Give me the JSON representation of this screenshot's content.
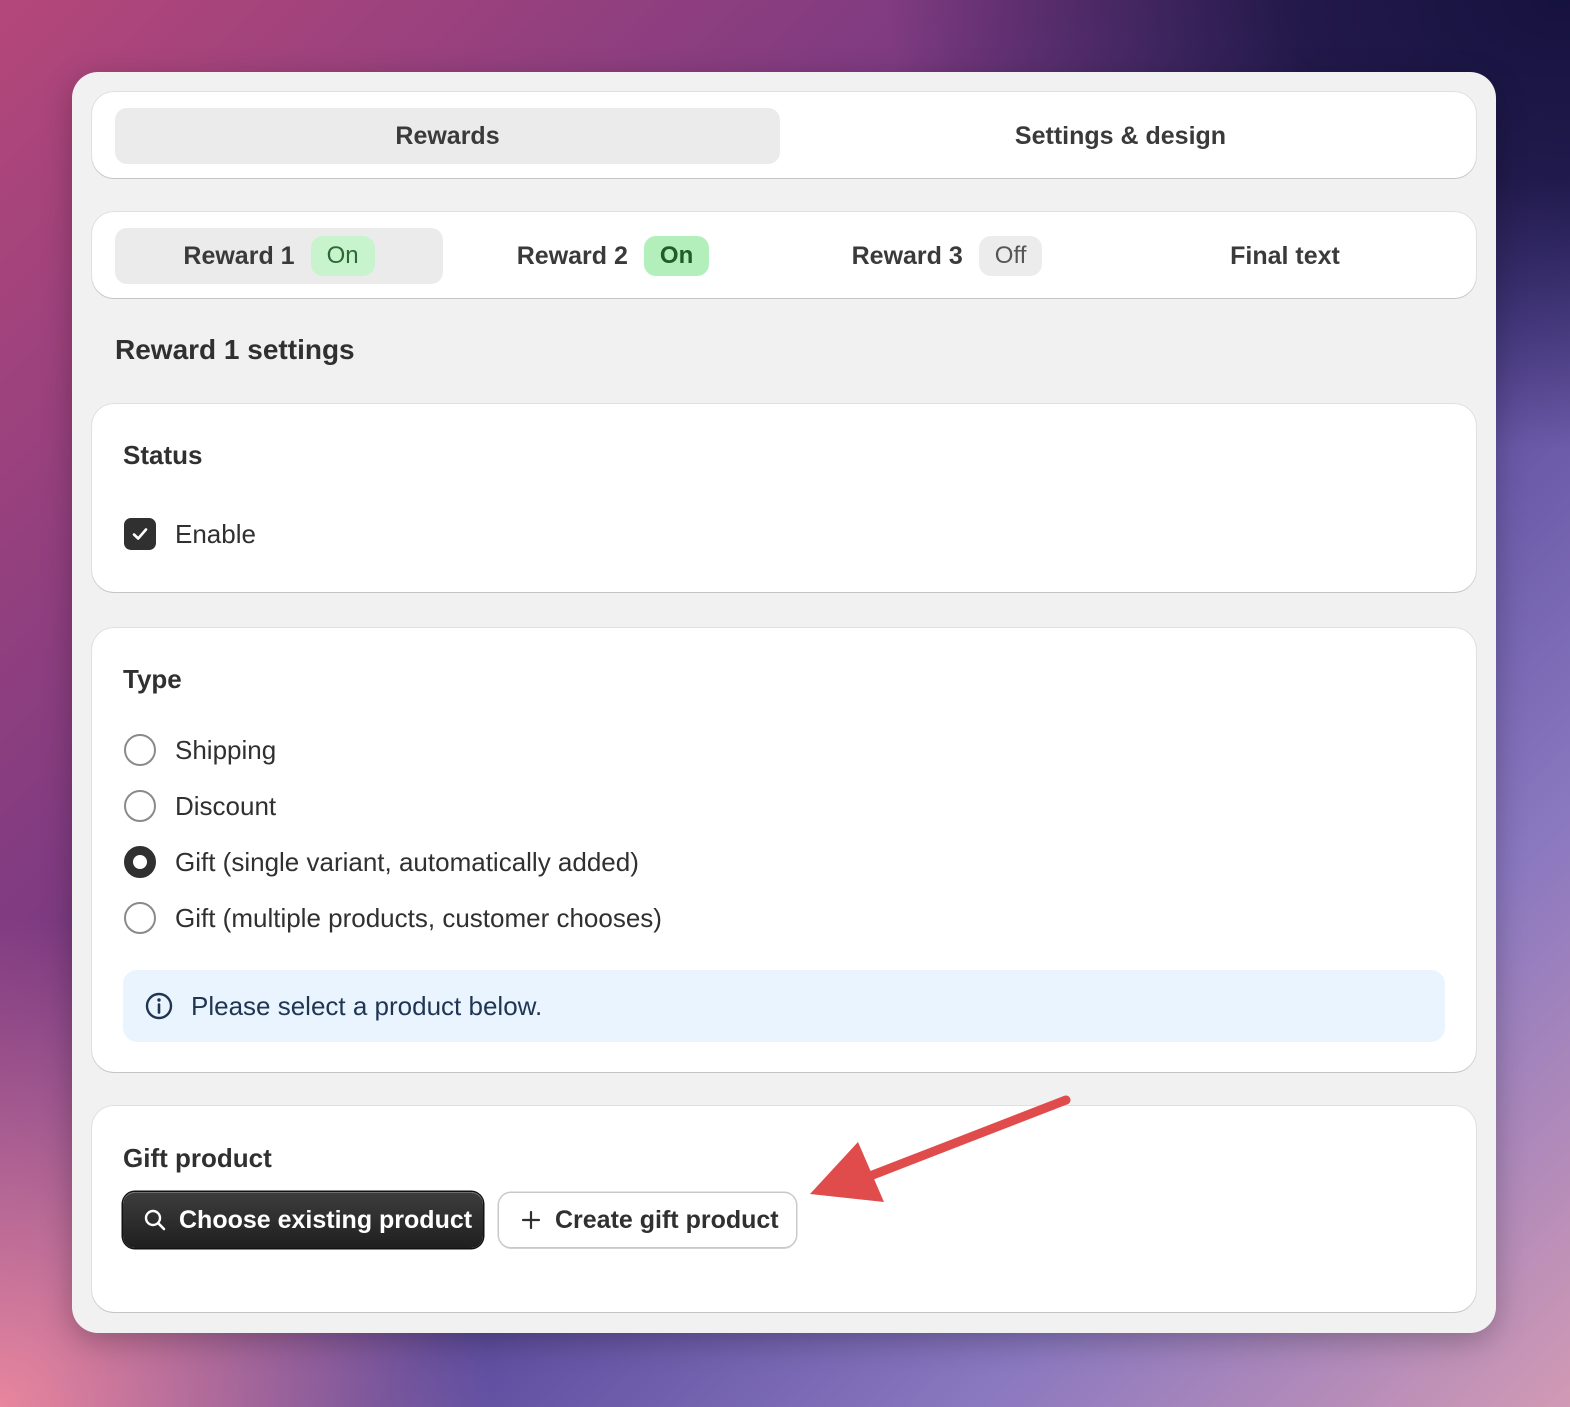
{
  "main_tabs": [
    {
      "label": "Rewards",
      "selected": true
    },
    {
      "label": "Settings & design",
      "selected": false
    }
  ],
  "reward_tabs": [
    {
      "label": "Reward 1",
      "badge": "On",
      "selected": true
    },
    {
      "label": "Reward 2",
      "badge": "On",
      "selected": false
    },
    {
      "label": "Reward 3",
      "badge": "Off",
      "selected": false
    },
    {
      "label": "Final text",
      "selected": false
    }
  ],
  "section_title": "Reward 1 settings",
  "status_card": {
    "title": "Status",
    "enable_label": "Enable",
    "enabled": true
  },
  "type_card": {
    "title": "Type",
    "options": [
      {
        "label": "Shipping",
        "checked": false
      },
      {
        "label": "Discount",
        "checked": false
      },
      {
        "label": "Gift (single variant, automatically added)",
        "checked": true
      },
      {
        "label": "Gift (multiple products, customer chooses)",
        "checked": false
      }
    ],
    "info_text": "Please select a product below."
  },
  "gift_card": {
    "title": "Gift product",
    "choose_button": "Choose existing product",
    "create_button": "Create gift product"
  },
  "colors": {
    "badge_on_bg": "#c7f4cd",
    "badge_off_bg": "#ececec",
    "primary_button": "#303030",
    "info_banner_bg": "#eaf4ff",
    "annotation_arrow": "#e04b4b"
  }
}
